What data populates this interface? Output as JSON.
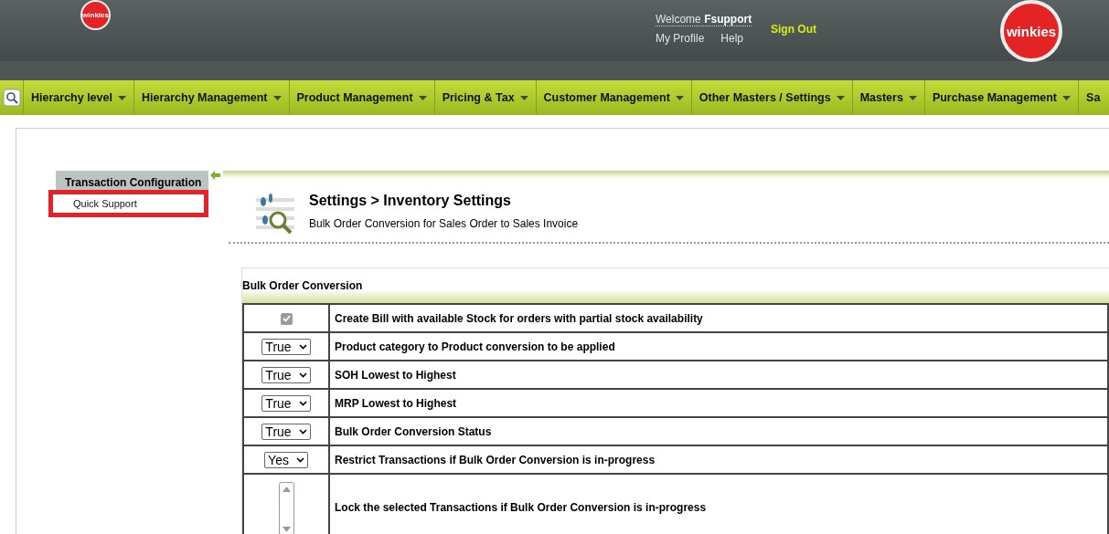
{
  "header": {
    "logo_small": "winkies",
    "welcome": "Welcome",
    "user": "Fsupport",
    "links": [
      "My Profile",
      "Help"
    ],
    "sign_out": "Sign Out",
    "logo_large": "winkies"
  },
  "nav": [
    "Hierarchy level",
    "Hierarchy Management",
    "Product Management",
    "Pricing & Tax",
    "Customer Management",
    "Other Masters / Settings",
    "Masters",
    "Purchase Management",
    "Sa"
  ],
  "sidebar": {
    "title": "Transaction Configuration",
    "items": [
      {
        "label": "Quick Support",
        "highlighted": true
      }
    ]
  },
  "page": {
    "title": "Settings > Inventory Settings",
    "subtitle": "Bulk Order Conversion for Sales Order to Sales Invoice"
  },
  "section": {
    "title": "Bulk Order Conversion",
    "rows": [
      {
        "kind": "checkbox",
        "checked": true,
        "label": "Create Bill with available Stock for orders with partial stock availability"
      },
      {
        "kind": "select",
        "value": "True",
        "label": "Product category to Product conversion to be applied"
      },
      {
        "kind": "select",
        "value": "True",
        "label": "SOH Lowest to Highest"
      },
      {
        "kind": "select",
        "value": "True",
        "label": "MRP Lowest to Highest"
      },
      {
        "kind": "select",
        "value": "True",
        "label": "Bulk Order Conversion Status"
      },
      {
        "kind": "select",
        "value": "Yes",
        "label": "Restrict Transactions if Bulk Order Conversion is in-progress"
      },
      {
        "kind": "listbox",
        "label": "Lock the selected Transactions if Bulk Order Conversion is in-progress"
      }
    ]
  }
}
